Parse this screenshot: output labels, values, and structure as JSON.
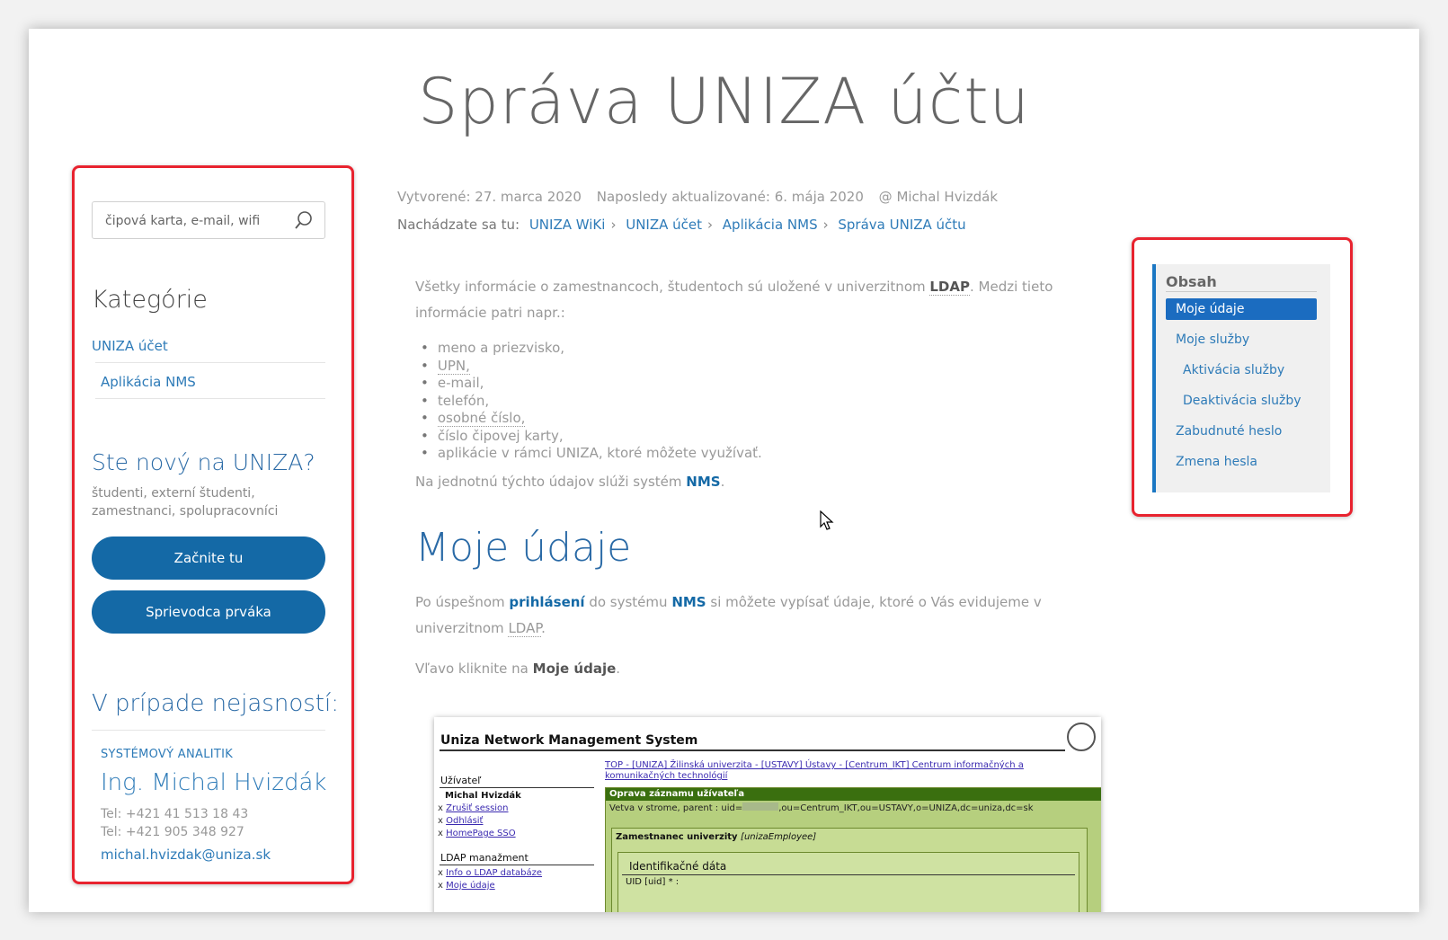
{
  "page_title": "Správa UNIZA účtu",
  "sidebar": {
    "search_placeholder": "čipová karta, e-mail, wifi",
    "categories_heading": "Kategórie",
    "categories": [
      "UNIZA účet",
      "Aplikácia NMS"
    ],
    "new_heading": "Ste nový na UNIZA?",
    "new_text": "študenti, externí študenti, zamestnanci, spolupracovníci",
    "btn_start": "Začnite tu",
    "btn_guide": "Sprievodca prváka",
    "help_heading": "V prípade nejasností:",
    "contact_role": "SYSTÉMOVÝ ANALITIK",
    "contact_name": "Ing. Michal Hvizdák",
    "contact_tel1": "Tel: +421 41 513 18 43",
    "contact_tel2": "Tel: +421 905 348 927",
    "contact_email": "michal.hvizdak@uniza.sk"
  },
  "meta": {
    "created": "Vytvorené: 27. marca 2020",
    "updated": "Naposledy aktualizované: 6. mája 2020",
    "author": "@ Michal Hvizdák"
  },
  "breadcrumb": {
    "prefix": "Nachádzate sa tu:",
    "items": [
      "UNIZA WiKi",
      "UNIZA účet",
      "Aplikácia NMS",
      "Správa UNIZA účtu"
    ]
  },
  "content": {
    "intro_a": "Všetky informácie o zamestnancoch, študentoch sú uložené v univerzitnom ",
    "intro_ldap": "LDAP",
    "intro_b": ". Medzi tieto informácie patri napr.:",
    "list": [
      "meno a priezvisko,",
      "UPN,",
      "e-mail,",
      "telefón,",
      "osobné číslo,",
      "číslo čipovej karty,",
      "aplikácie v rámci UNIZA, ktoré môžete využívať."
    ],
    "nms_a": "Na jednotnú týchto údajov slúži systém ",
    "nms_b": "NMS",
    "nms_c": ".",
    "h2": "Moje údaje",
    "p2_a": "Po úspešnom ",
    "p2_login": "prihlásení",
    "p2_b": " do systému ",
    "p2_nms": "NMS",
    "p2_c": " si môžete vypísať údaje, ktoré o Vás evidujeme v univerzitnom ",
    "p2_ldap": "LDAP",
    "p2_d": ".",
    "p3_a": "Vľavo kliknite na ",
    "p3_b": "Moje údaje",
    "p3_c": "."
  },
  "nms_screenshot": {
    "title": "Uniza Network Management System",
    "nav": "TOP - [UNIZA] Žilinská univerzita - [USTAVY] Ústavy - [Centrum_IKT] Centrum informačných a komunikačných technológií",
    "user_heading": "Užívateľ",
    "user_name": "Michal Hvizdák",
    "user_links": [
      "Zrušiť session",
      "Odhlásiť",
      "HomePage SSO"
    ],
    "ldap_heading": "LDAP manažment",
    "ldap_links": [
      "Info o LDAP databáze",
      "Moje údaje"
    ],
    "edit_heading": "Oprava záznamu užívateľa",
    "branch": "Vetva v strome, parent : uid=",
    "branch_rest": ",ou=Centrum_IKT,ou=USTAVY,o=UNIZA,dc=uniza,dc=sk",
    "employee": "Zamestnanec univerzity",
    "employee_class": "[unizaEmployee]",
    "id_heading": "Identifikačné dáta",
    "uid_row": "UID [uid] * :"
  },
  "toc": {
    "title": "Obsah",
    "items": [
      "Moje údaje",
      "Moje služby",
      "Aktivácia služby",
      "Deaktivácia služby",
      "Zabudnuté heslo",
      "Zmena hesla"
    ]
  },
  "colors": {
    "accent": "#1469a6",
    "highlight_border": "#e8232f",
    "toc_active": "#1b6cc0"
  }
}
